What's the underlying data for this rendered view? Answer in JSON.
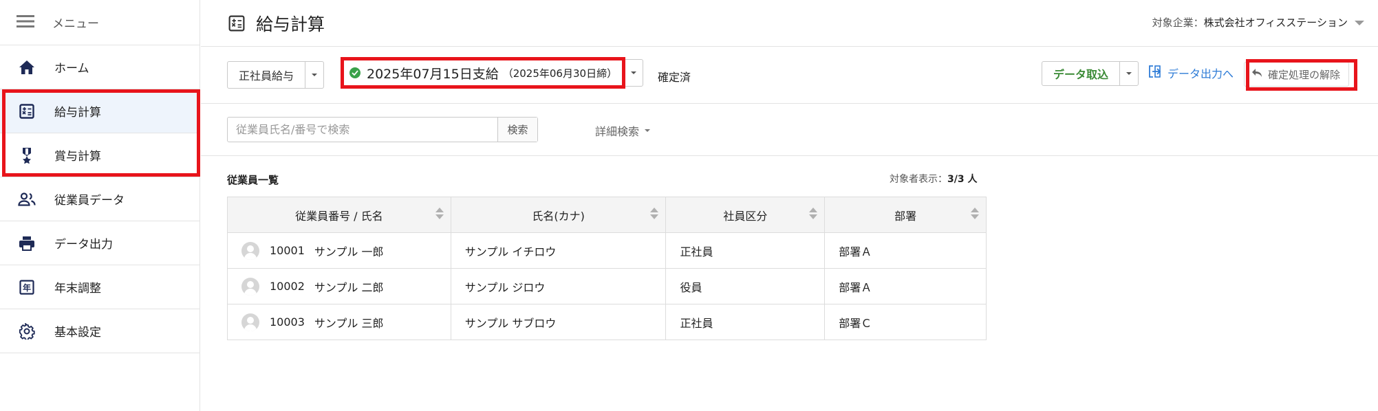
{
  "sidebar": {
    "menu_label": "メニュー",
    "items": [
      {
        "label": "ホーム",
        "icon": "home-icon"
      },
      {
        "label": "給与計算",
        "icon": "calculator-icon",
        "active": true
      },
      {
        "label": "賞与計算",
        "icon": "award-icon"
      },
      {
        "label": "従業員データ",
        "icon": "people-icon"
      },
      {
        "label": "データ出力",
        "icon": "printer-icon"
      },
      {
        "label": "年末調整",
        "icon": "year-icon"
      },
      {
        "label": "基本設定",
        "icon": "gear-icon"
      }
    ]
  },
  "header": {
    "title": "給与計算",
    "company_prefix": "対象企業：",
    "company_name": "株式会社オフィスステーション"
  },
  "toolbar": {
    "payroll_type": "正社員給与",
    "period_main": "2025年07月15日支給",
    "period_sub": "（2025年06月30日締）",
    "status": "確定済",
    "import_label": "データ取込",
    "export_label": "データ出力へ",
    "release_label": "確定処理の解除"
  },
  "search": {
    "placeholder": "従業員氏名/番号で検索",
    "button": "検索",
    "advanced": "詳細検索"
  },
  "list": {
    "title": "従業員一覧",
    "count_label": "対象者表示：",
    "count_value": "3/3 人",
    "columns": [
      "従業員番号 / 氏名",
      "氏名(カナ)",
      "社員区分",
      "部署"
    ],
    "rows": [
      {
        "no": "10001",
        "name": "サンプル 一郎",
        "kana": "サンプル イチロウ",
        "type": "正社員",
        "dept": "部署Ａ"
      },
      {
        "no": "10002",
        "name": "サンプル 二郎",
        "kana": "サンプル ジロウ",
        "type": "役員",
        "dept": "部署Ａ"
      },
      {
        "no": "10003",
        "name": "サンプル 三郎",
        "kana": "サンプル サブロウ",
        "type": "正社員",
        "dept": "部署Ｃ"
      }
    ]
  },
  "colors": {
    "highlight": "#e8141b",
    "nav_icon": "#1e2a56",
    "accent_link": "#2d7bd6",
    "import_green": "#3a8a35",
    "check_green": "#3aa14a"
  }
}
